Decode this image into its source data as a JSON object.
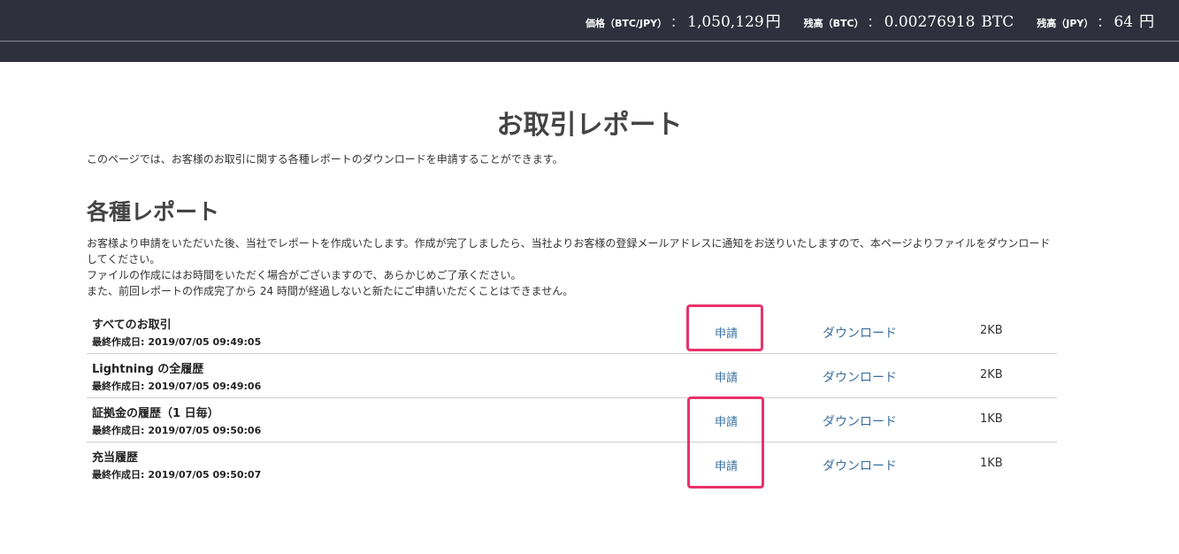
{
  "header": {
    "price": {
      "label": "価格（BTC/JPY）",
      "value": "1,050,129",
      "unit": "円"
    },
    "balance_btc": {
      "label": "残高（BTC）",
      "value": "0.00276918",
      "unit": "BTC"
    },
    "balance_jpy": {
      "label": "残高（JPY）",
      "value": "64",
      "unit": "円"
    },
    "colon": "："
  },
  "page": {
    "title": "お取引レポート",
    "intro": "このページでは、お客様のお取引に関する各種レポートのダウンロードを申請することができます。"
  },
  "section": {
    "title": "各種レポート",
    "notes": [
      "お客様より申請をいただいた後、当社でレポートを作成いたします。作成が完了しましたら、当社よりお客様の登録メールアドレスに通知をお送りいたしますので、本ページよりファイルをダウンロード",
      "してください。",
      "ファイルの作成にはお時間をいただく場合がございますので、あらかじめご了承ください。",
      "また、前回レポートの作成完了から 24 時間が経過しないと新たにご申請いただくことはできません。"
    ]
  },
  "reports": {
    "date_label": "最終作成日:",
    "apply_label": "申請",
    "download_label": "ダウンロード",
    "rows": [
      {
        "name": "すべてのお取引",
        "date": "2019/07/05 09:49:05",
        "size": "2KB"
      },
      {
        "name": "Lightning の全履歴",
        "date": "2019/07/05 09:49:06",
        "size": "2KB"
      },
      {
        "name": "証拠金の履歴（1 日毎）",
        "date": "2019/07/05 09:50:06",
        "size": "1KB"
      },
      {
        "name": "充当履歴",
        "date": "2019/07/05 09:50:07",
        "size": "1KB"
      }
    ]
  },
  "colors": {
    "topbar": "#2e303d",
    "link": "#3a6fa0",
    "highlight": "#e8336b"
  }
}
